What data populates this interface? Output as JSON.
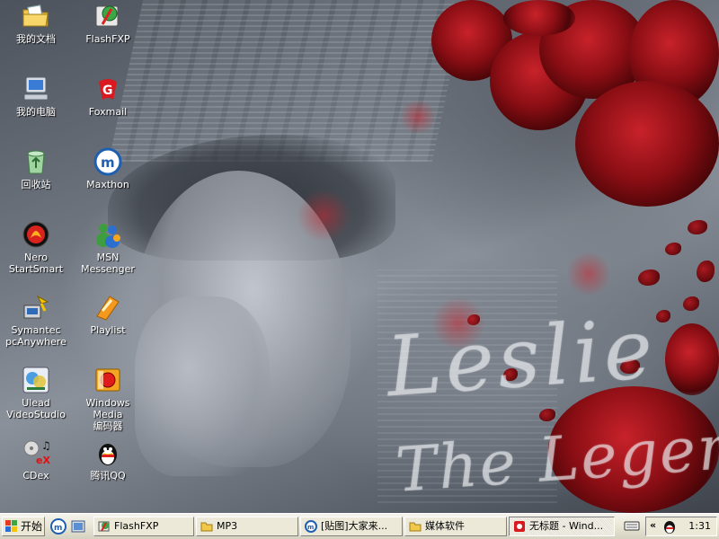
{
  "desktop": {
    "wallpaper": {
      "title": "Leslie",
      "subtitle": "The Legend"
    },
    "icons": [
      {
        "label": "我的文档",
        "icon": "folder-documents-icon"
      },
      {
        "label": "FlashFXP",
        "icon": "flashfxp-icon"
      },
      {
        "label": "我的电脑",
        "icon": "computer-icon"
      },
      {
        "label": "Foxmail",
        "icon": "foxmail-icon"
      },
      {
        "label": "回收站",
        "icon": "recycle-bin-icon"
      },
      {
        "label": "Maxthon",
        "icon": "maxthon-icon"
      },
      {
        "label": "Nero\nStartSmart",
        "icon": "nero-icon"
      },
      {
        "label": "MSN Messenger",
        "icon": "msn-icon"
      },
      {
        "label": "Symantec\npcAnywhere",
        "icon": "pcanywhere-icon"
      },
      {
        "label": "Playlist",
        "icon": "playlist-icon"
      },
      {
        "label": "Ulead\nVideoStudio",
        "icon": "videostudio-icon"
      },
      {
        "label": "Windows Media\n编码器",
        "icon": "media-encoder-icon"
      },
      {
        "label": "CDex",
        "icon": "cdex-icon"
      },
      {
        "label": "腾讯QQ",
        "icon": "qq-icon"
      }
    ]
  },
  "taskbar": {
    "start_label": "开始",
    "quick_launch": [
      "maxthon-icon",
      "show-desktop-icon"
    ],
    "tasks": [
      {
        "label": "FlashFXP",
        "icon": "flashfxp-icon"
      },
      {
        "label": "MP3",
        "icon": "folder-icon"
      },
      {
        "label": "[贴图]大家来...",
        "icon": "maxthon-icon"
      },
      {
        "label": "媒体软件",
        "icon": "folder-icon"
      },
      {
        "label": "无标题 - Wind...",
        "icon": "app-icon"
      }
    ],
    "tray": {
      "arrow": "«",
      "clock": "1:31"
    }
  },
  "colors": {
    "taskbar_bg": "#ece9d8",
    "rose_red": "#a81a20",
    "icon_text": "#ffffff"
  }
}
